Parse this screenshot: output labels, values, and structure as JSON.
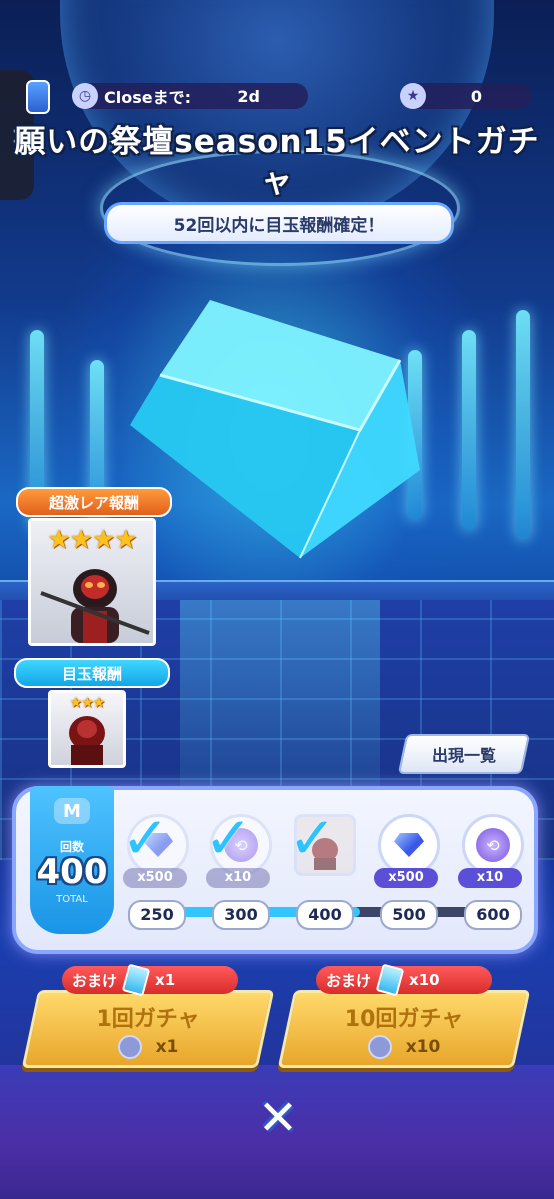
{
  "header": {
    "timer_label": "Closeまで:",
    "timer_value": "2d",
    "coin_value": "0",
    "side_tab_icon": "chevron-right-icon"
  },
  "title": "願いの祭壇season15イベントガチャ",
  "banner": "52回以内に目玉報酬確定！",
  "rewards": {
    "super_rare_label": "超激レア報酬",
    "super_rare_stars": "★★★★",
    "main_label": "目玉報酬",
    "main_stars": "★★★"
  },
  "appear_button": "出現一覧",
  "progress": {
    "count_label": "回数",
    "count_value": "400",
    "total_label": "TOTAL",
    "milestones": [
      {
        "at": "250",
        "qty": "x500",
        "icon": "gem-icon",
        "claimed": true
      },
      {
        "at": "300",
        "qty": "x10",
        "icon": "medal-icon",
        "claimed": true
      },
      {
        "at": "400",
        "qty": "",
        "icon": "character-card-icon",
        "claimed": true
      },
      {
        "at": "500",
        "qty": "x500",
        "icon": "gem-icon",
        "claimed": false
      },
      {
        "at": "600",
        "qty": "x10",
        "icon": "medal-icon",
        "claimed": false
      }
    ]
  },
  "gacha": {
    "bonus_label": "おまけ",
    "single": {
      "bonus_count": "x1",
      "label": "1回ガチャ",
      "cost": "x1"
    },
    "multi": {
      "bonus_count": "x10",
      "label": "10回ガチャ",
      "cost": "x10"
    }
  },
  "colors": {
    "accent": "#32c5ff",
    "bonus_red": "#d92b2b",
    "button_gold": "#e8a62b"
  }
}
